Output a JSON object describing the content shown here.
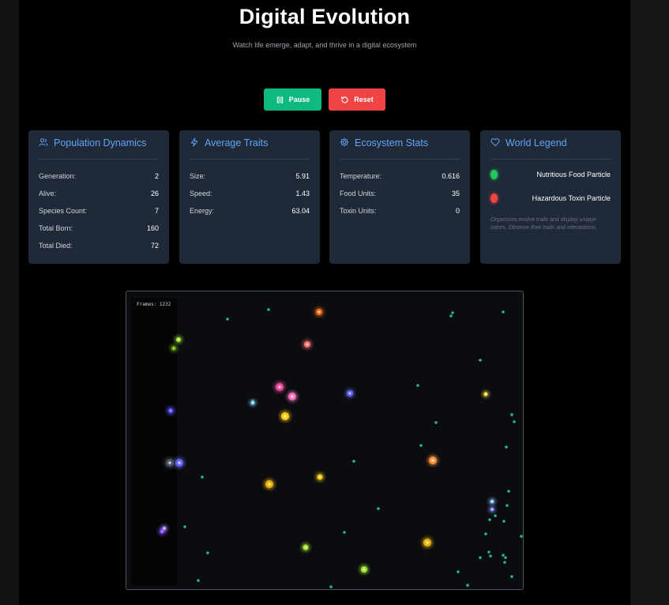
{
  "header": {
    "title": "Digital Evolution",
    "subtitle": "Watch life emerge, adapt, and thrive in a digital ecosystem"
  },
  "controls": {
    "pause_label": "Pause",
    "reset_label": "Reset"
  },
  "colors": {
    "accent_blue": "#60a5fa",
    "pause_green": "#10b981",
    "reset_red": "#ef4444",
    "card_bg": "#1f2937",
    "food_green": "#22c55e",
    "toxin_red": "#ef4444"
  },
  "cards": {
    "population": {
      "title": "Population Dynamics",
      "icon": "users-icon",
      "rows": [
        {
          "label": "Generation:",
          "value": "2"
        },
        {
          "label": "Alive:",
          "value": "26"
        },
        {
          "label": "Species Count:",
          "value": "7"
        },
        {
          "label": "Total Born:",
          "value": "160"
        },
        {
          "label": "Total Died:",
          "value": "72"
        }
      ]
    },
    "traits": {
      "title": "Average Traits",
      "icon": "lightning-icon",
      "rows": [
        {
          "label": "Size:",
          "value": "5.91"
        },
        {
          "label": "Speed:",
          "value": "1.43"
        },
        {
          "label": "Energy:",
          "value": "63.04"
        }
      ]
    },
    "ecosystem": {
      "title": "Ecosystem Stats",
      "icon": "gear-icon",
      "rows": [
        {
          "label": "Temperature:",
          "value": "0.616"
        },
        {
          "label": "Food Units:",
          "value": "35"
        },
        {
          "label": "Toxin Units:",
          "value": "0"
        }
      ]
    },
    "legend": {
      "title": "World Legend",
      "icon": "heart-icon",
      "items": [
        {
          "label": "Nutritious Food Particle",
          "color": "#22c55e"
        },
        {
          "label": "Hazardous Toxin Particle",
          "color": "#ef4444"
        }
      ],
      "note": "Organisms evolve traits and display unique colors. Observe their trails and interactions."
    }
  },
  "simulation": {
    "frames_label": "Frames: 1232"
  }
}
